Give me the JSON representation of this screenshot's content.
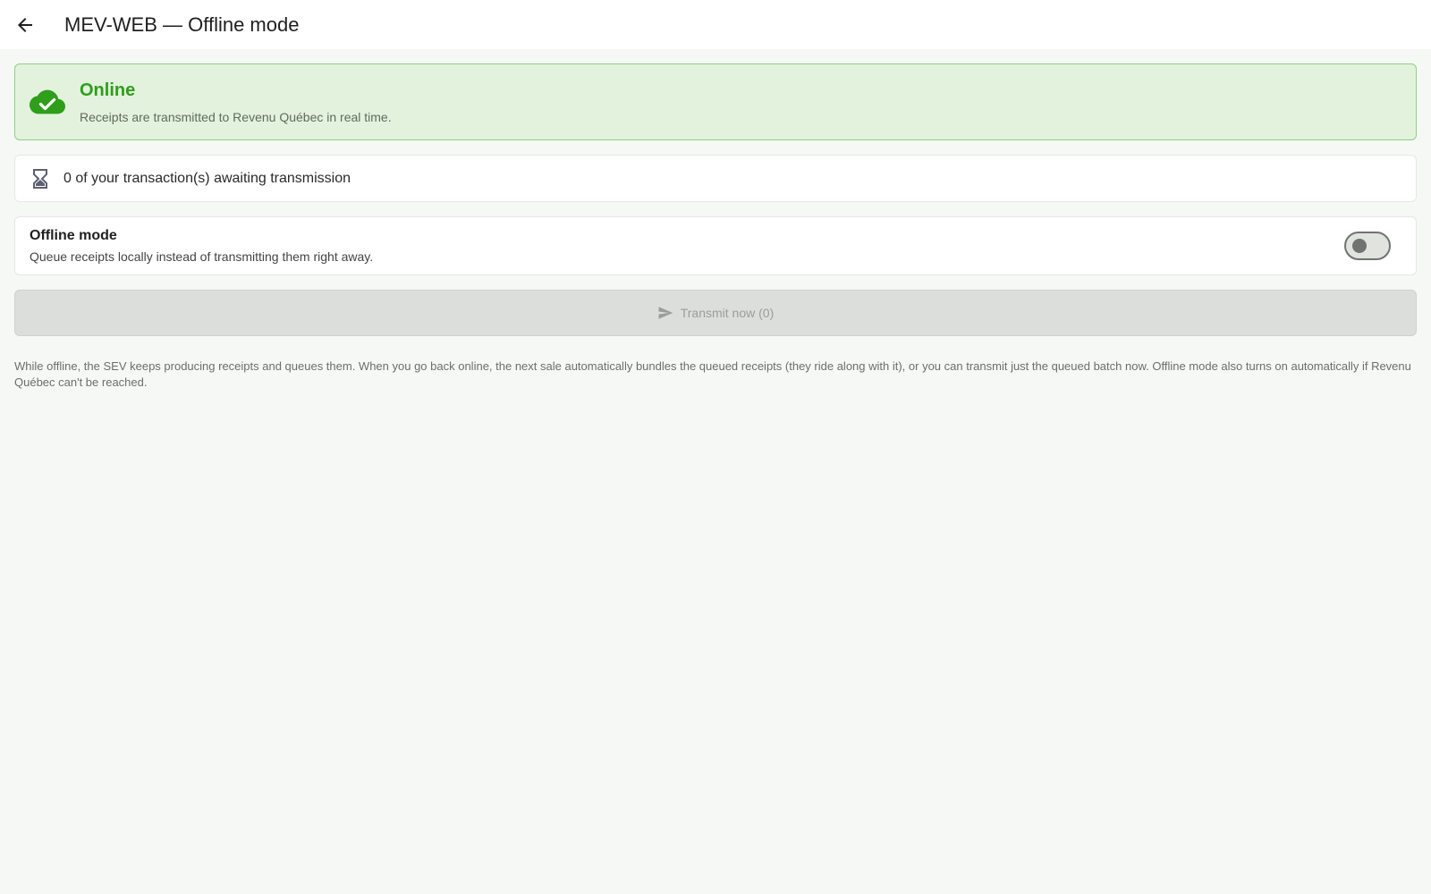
{
  "header": {
    "title": "MEV-WEB — Offline mode",
    "back_icon": "arrow-left-icon"
  },
  "status": {
    "icon": "cloud-check-icon",
    "title": "Online",
    "description": "Receipts are transmitted to Revenu Québec in real time.",
    "accent_color": "#2e9e1b"
  },
  "pending": {
    "icon": "hourglass-icon",
    "text": "0 of your transaction(s) awaiting transmission"
  },
  "offline_mode": {
    "title": "Offline mode",
    "description": "Queue receipts locally instead of transmitting them right away.",
    "enabled": false
  },
  "transmit": {
    "icon": "send-icon",
    "label": "Transmit now (0)",
    "disabled": true
  },
  "help": {
    "text": "While offline, the SEV keeps producing receipts and queues them. When you go back online, the next sale automatically bundles the queued receipts (they ride along with it), or you can transmit just the queued batch now. Offline mode also turns on automatically if Revenu Québec can't be reached."
  }
}
